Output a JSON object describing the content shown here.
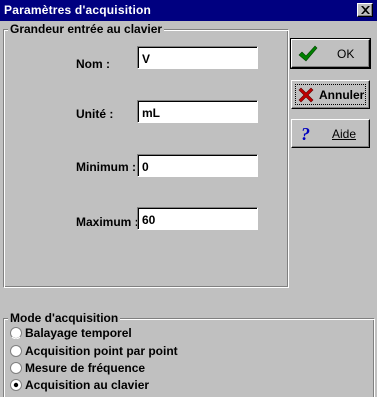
{
  "window": {
    "title": "Paramètres d'acquisition"
  },
  "input_group": {
    "legend": "Grandeur entrée au clavier",
    "fields": [
      {
        "label": "Nom :",
        "value": "V"
      },
      {
        "label": "Unité :",
        "value": "mL"
      },
      {
        "label": "Minimum :",
        "value": "0"
      },
      {
        "label": "Maximum :",
        "value": "60"
      }
    ]
  },
  "buttons": {
    "ok": {
      "label": "OK",
      "icon": "checkmark-icon",
      "color": "#008000"
    },
    "cancel": {
      "label": "Annuler",
      "icon": "cross-icon",
      "color": "#c00000"
    },
    "help": {
      "label": "Aide",
      "icon": "question-icon",
      "color": "#0000c0"
    }
  },
  "mode_group": {
    "legend": "Mode d'acquisition",
    "options": [
      {
        "label": "Balayage temporel",
        "selected": false
      },
      {
        "label": "Acquisition point par point",
        "selected": false
      },
      {
        "label": "Mesure de fréquence",
        "selected": false
      },
      {
        "label": "Acquisition au clavier",
        "selected": true
      }
    ]
  }
}
